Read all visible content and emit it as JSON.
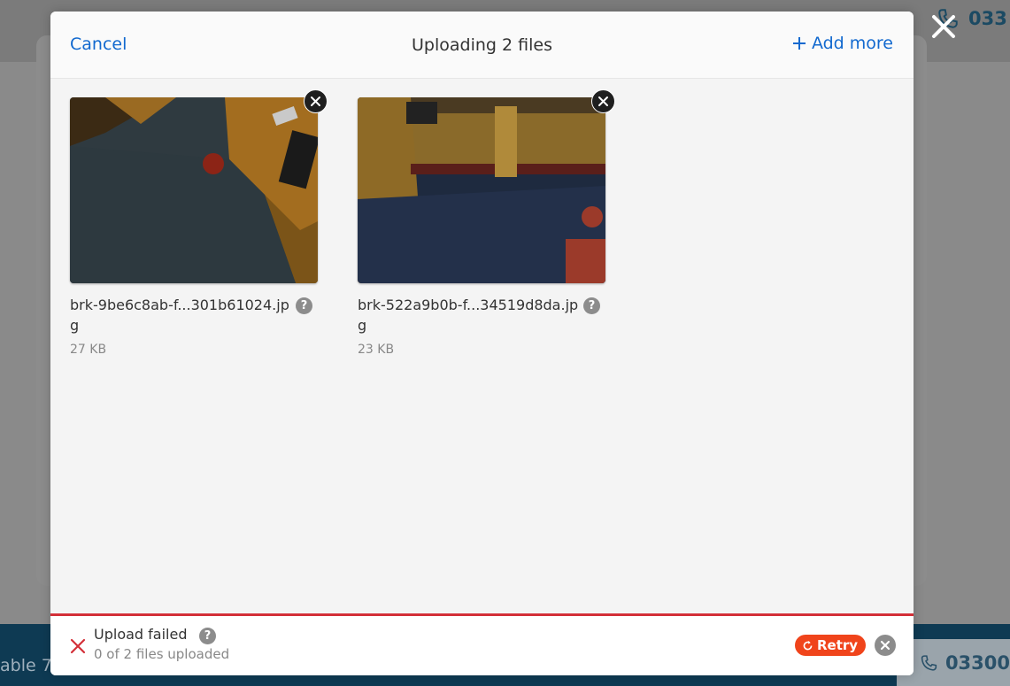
{
  "background": {
    "phone_top": "033",
    "phone_bottom": "03300",
    "bottom_text": "able 7"
  },
  "modal": {
    "title": "Uploading 2 files",
    "cancel_label": "Cancel",
    "add_more_label": "Add more",
    "files": [
      {
        "name": "brk-9be6c8ab-f...301b61024.jpg",
        "size": "27 KB"
      },
      {
        "name": "brk-522a9b0b-f...34519d8da.jpg",
        "size": "23 KB"
      }
    ],
    "status": {
      "title": "Upload failed",
      "subtitle": "0 of 2 files uploaded",
      "retry_label": "Retry",
      "help": "?"
    }
  },
  "colors": {
    "accent": "#1269cf",
    "error": "#d32f38",
    "retry": "#f0441b"
  },
  "icons": {
    "cancel": "none",
    "add": "plus-icon",
    "remove": "close-icon",
    "help": "question-icon",
    "error": "x-icon",
    "retry": "refresh-icon",
    "phone": "phone-icon"
  }
}
